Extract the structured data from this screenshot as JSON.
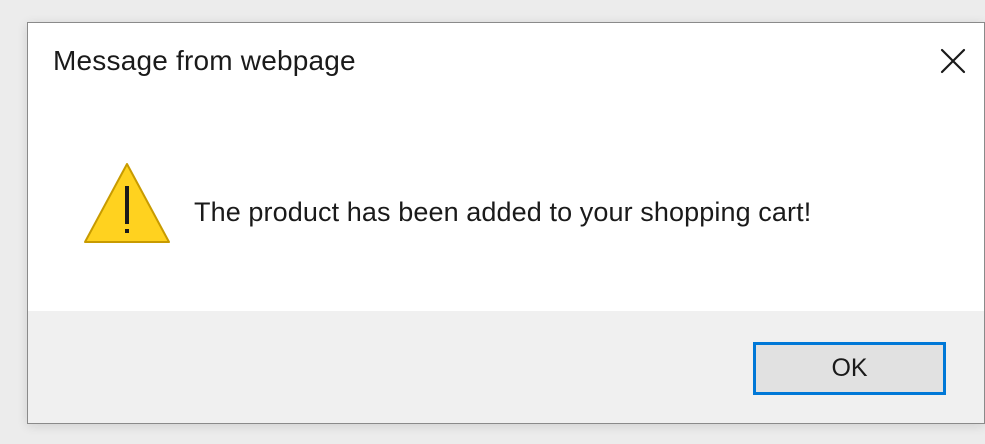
{
  "dialog": {
    "title": "Message from webpage",
    "message": "The product has been added to your shopping cart!",
    "ok_label": "OK"
  },
  "icons": {
    "close": "close-icon",
    "warning": "warning-icon"
  },
  "colors": {
    "warning_fill": "#ffd21f",
    "warning_border": "#c89b00",
    "focus_border": "#0078d7",
    "footer_bg": "#f0f0f0"
  }
}
